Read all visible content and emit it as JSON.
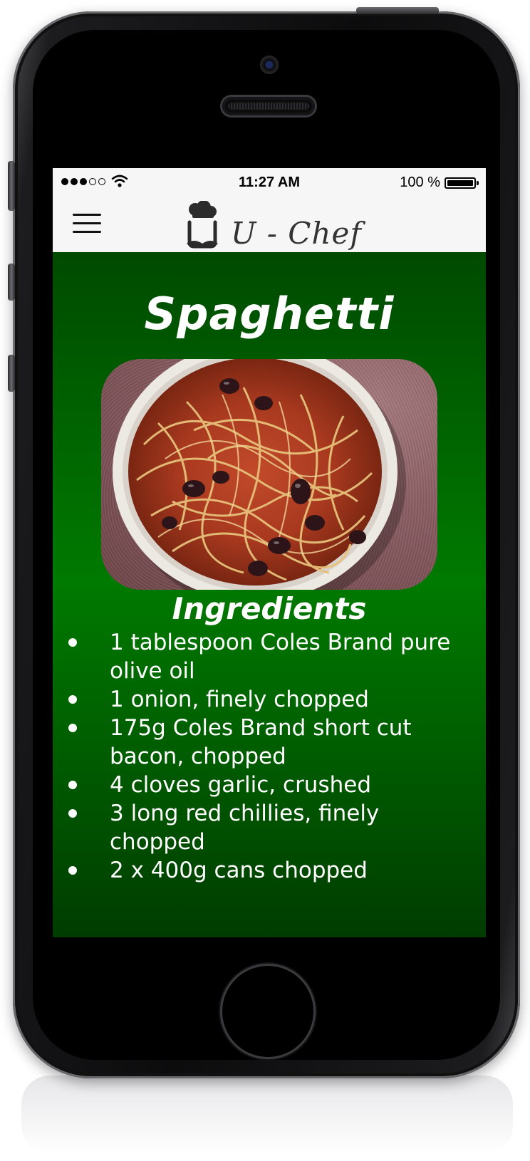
{
  "status_bar": {
    "time": "11:27 AM",
    "battery_percent": "100 %",
    "signal_bars_filled": 3,
    "signal_bars_total": 5
  },
  "nav_bar": {
    "menu_icon": "hamburger-menu-icon",
    "logo_icon": "chef-hat-mustache-icon",
    "app_name": "U - Chef"
  },
  "recipe": {
    "title": "Spaghetti",
    "image_subject": "bowl of spaghetti with tomato sauce and olives",
    "ingredients_heading": "Ingredients",
    "ingredients": [
      "1 tablespoon Coles Brand pure olive oil",
      " 1 onion, finely chopped",
      " 175g Coles Brand short cut bacon, chopped",
      " 4 cloves garlic, crushed",
      " 3 long red chillies, finely chopped",
      " 2 x 400g cans chopped"
    ]
  },
  "colors": {
    "header_bg": "#f6f6f6",
    "content_green_top": "#004a00",
    "content_green_mid": "#007a00",
    "content_green_bottom": "#003c00",
    "text_on_green": "#ffffff"
  }
}
